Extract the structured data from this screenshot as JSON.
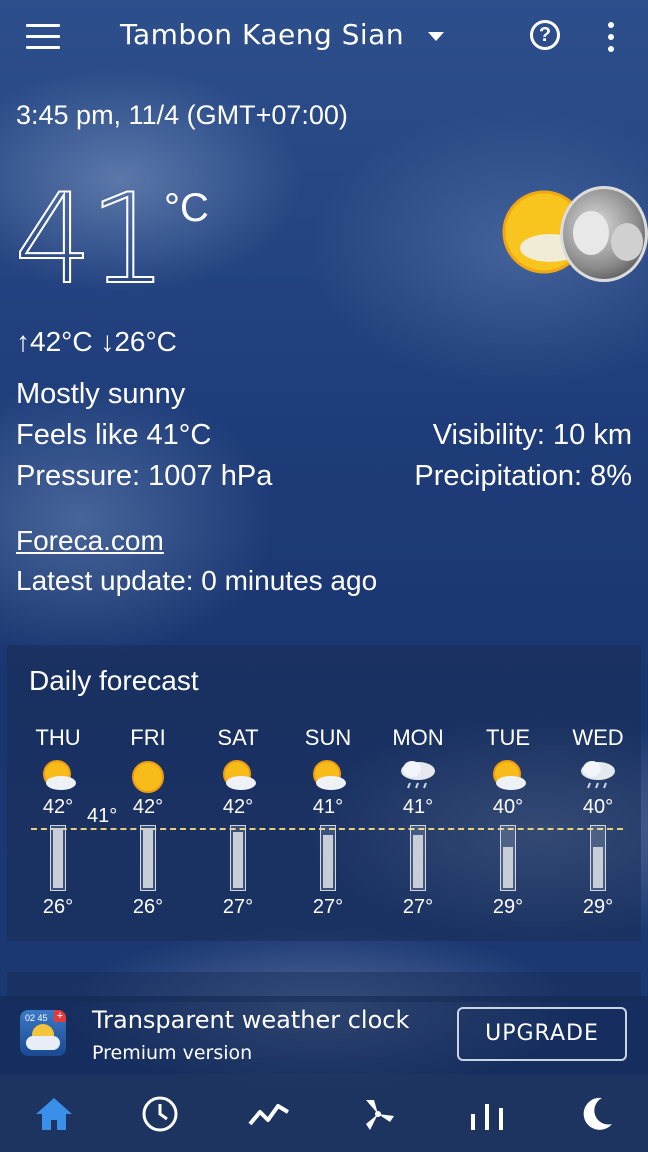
{
  "header": {
    "location": "Tambon Kaeng Sian",
    "icons": [
      "menu-icon",
      "chevron-down-icon",
      "help-icon",
      "more-vert-icon"
    ]
  },
  "current": {
    "datetime": "3:45 pm, 11/4 (GMT+07:00)",
    "temperature": "41",
    "unit": "°C",
    "high": "42°C",
    "low": "26°C",
    "condition": "Mostly sunny",
    "feels_like": "Feels like 41°C",
    "pressure": "Pressure: 1007 hPa",
    "visibility": "Visibility: 10 km",
    "precipitation": "Precipitation: 8%",
    "source": "Foreca.com",
    "latest_update": "Latest update: 0 minutes ago",
    "now_temp": "41°"
  },
  "daily": {
    "title": "Daily forecast",
    "days": [
      {
        "name": "THU",
        "icon": "partly-cloudy-icon",
        "high": "42°",
        "low": "26°",
        "high_c": 42,
        "low_c": 26
      },
      {
        "name": "FRI",
        "icon": "sunny-icon",
        "high": "42°",
        "low": "26°",
        "high_c": 42,
        "low_c": 26
      },
      {
        "name": "SAT",
        "icon": "partly-cloudy-icon",
        "high": "42°",
        "low": "27°",
        "high_c": 42,
        "low_c": 27
      },
      {
        "name": "SUN",
        "icon": "partly-cloudy-icon",
        "high": "41°",
        "low": "27°",
        "high_c": 41,
        "low_c": 27
      },
      {
        "name": "MON",
        "icon": "rain-cloud-icon",
        "high": "41°",
        "low": "27°",
        "high_c": 41,
        "low_c": 27
      },
      {
        "name": "TUE",
        "icon": "partly-cloudy-icon",
        "high": "40°",
        "low": "29°",
        "high_c": 40,
        "low_c": 29
      },
      {
        "name": "WED",
        "icon": "rain-cloud-icon",
        "high": "40°",
        "low": "29°",
        "high_c": 40,
        "low_c": 29
      }
    ]
  },
  "promo": {
    "title": "Transparent weather clock",
    "subtitle": "Premium version",
    "button": "UPGRADE",
    "icon_clock": "02 45"
  },
  "nav": {
    "items": [
      "home-icon",
      "clock-icon",
      "graph-icon",
      "wind-icon",
      "bar-chart-icon",
      "moon-icon"
    ],
    "active_color": "#3a8fe8"
  }
}
